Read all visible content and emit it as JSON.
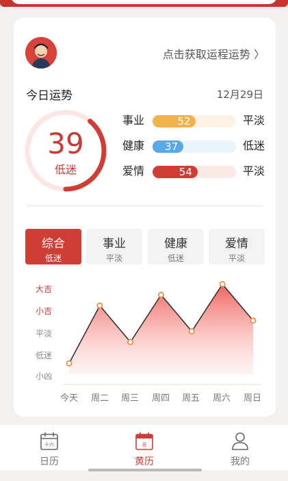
{
  "header": {
    "fortune_link": "点击获取运程运势 〉",
    "title": "今日运势",
    "date": "12月29日"
  },
  "score": {
    "value": "39",
    "level": "低迷",
    "ring_fraction": 0.39
  },
  "bars": [
    {
      "label": "事业",
      "value": "52",
      "status": "平淡",
      "fraction": 0.52,
      "color": "#f1b44c",
      "track": "#fdf3e4"
    },
    {
      "label": "健康",
      "value": "37",
      "status": "低迷",
      "fraction": 0.37,
      "color": "#5aa8e6",
      "track": "#eaf4fb"
    },
    {
      "label": "爱情",
      "value": "54",
      "status": "平淡",
      "fraction": 0.54,
      "color": "#cf3d35",
      "track": "#fbe9e8"
    }
  ],
  "tabs": [
    {
      "label": "综合",
      "sub": "低迷"
    },
    {
      "label": "事业",
      "sub": "平淡"
    },
    {
      "label": "健康",
      "sub": "低迷"
    },
    {
      "label": "爱情",
      "sub": "平淡"
    }
  ],
  "chart_data": {
    "type": "area",
    "categories": [
      "今天",
      "周二",
      "周三",
      "周四",
      "周五",
      "周六",
      "周日"
    ],
    "y_levels": [
      "大吉",
      "小吉",
      "平淡",
      "低迷",
      "小凶"
    ],
    "values": [
      0.5,
      3.2,
      1.5,
      3.7,
      2.0,
      4.2,
      2.5
    ],
    "ylim": [
      0,
      4
    ],
    "line_color": "#333333",
    "point_color": "#f08a43",
    "fill_color": "#f36a63"
  },
  "nav": [
    {
      "label": "日历",
      "icon": "calendar-icon",
      "badge": "十六"
    },
    {
      "label": "黄历",
      "icon": "almanac-icon",
      "badge": "吉"
    },
    {
      "label": "我的",
      "icon": "user-icon"
    }
  ]
}
